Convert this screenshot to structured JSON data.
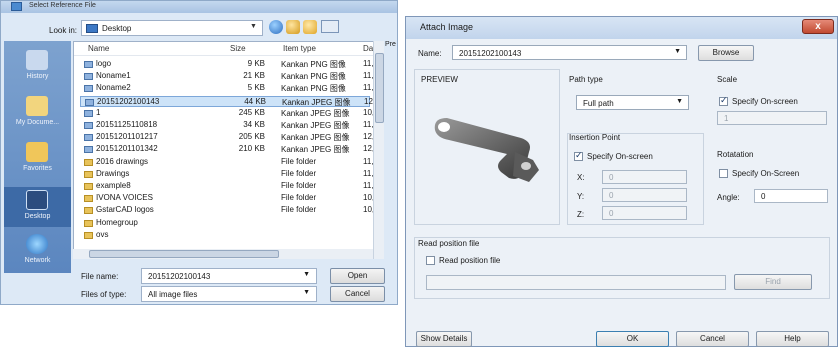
{
  "file_dialog": {
    "title": "Select Reference File",
    "look_in_label": "Look in:",
    "look_in_value": "Desktop",
    "places": [
      "History",
      "My Docume...",
      "Desktop",
      "Favorites",
      "Network"
    ],
    "columns": {
      "name": "Name",
      "size": "Size",
      "type": "Item type",
      "date": "Da"
    },
    "rows": [
      {
        "name": "logo",
        "size": "9 KB",
        "type": "Kankan PNG 图像",
        "date": "11,"
      },
      {
        "name": "Noname1",
        "size": "21 KB",
        "type": "Kankan PNG 图像",
        "date": "11,"
      },
      {
        "name": "Noname2",
        "size": "5 KB",
        "type": "Kankan PNG 图像",
        "date": "11,"
      },
      {
        "name": "20151202100143",
        "size": "44 KB",
        "type": "Kankan JPEG 图像",
        "date": "12,"
      },
      {
        "name": "1",
        "size": "245 KB",
        "type": "Kankan JPEG 图像",
        "date": "10,"
      },
      {
        "name": "20151125110818",
        "size": "34 KB",
        "type": "Kankan JPEG 图像",
        "date": "11,"
      },
      {
        "name": "20151201101217",
        "size": "205 KB",
        "type": "Kankan JPEG 图像",
        "date": "12,"
      },
      {
        "name": "20151201101342",
        "size": "210 KB",
        "type": "Kankan JPEG 图像",
        "date": "12,"
      },
      {
        "name": "2016 drawings",
        "size": "",
        "type": "File folder",
        "date": "11,"
      },
      {
        "name": "Drawings",
        "size": "",
        "type": "File folder",
        "date": "11,"
      },
      {
        "name": "example8",
        "size": "",
        "type": "File folder",
        "date": "11,"
      },
      {
        "name": "IVONA VOICES",
        "size": "",
        "type": "File folder",
        "date": "10,"
      },
      {
        "name": "GstarCAD logos",
        "size": "",
        "type": "File folder",
        "date": "10,"
      },
      {
        "name": "Homegroup",
        "size": "",
        "type": "",
        "date": ""
      },
      {
        "name": "ovs",
        "size": "",
        "type": "",
        "date": ""
      }
    ],
    "selected_row": 3,
    "file_name_label": "File name:",
    "file_name_value": "20151202100143",
    "files_of_type_label": "Files of type:",
    "files_of_type_value": "All image files",
    "open_label": "Open",
    "cancel_label": "Cancel",
    "pre_label": "Pre"
  },
  "attach_dialog": {
    "title": "Attach Image",
    "close_label": "x",
    "name_label": "Name:",
    "name_value": "20151202100143",
    "browse_label": "Browse",
    "preview_label": "PREVIEW",
    "path_type_label": "Path type",
    "path_type_value": "Full path",
    "scale_label": "Scale",
    "scale_checkbox_label": "Specify On-screen",
    "scale_value": "1",
    "insertion_label": "Insertion Point",
    "insertion_checkbox_label": "Specify On-screen",
    "x_label": "X:",
    "x_value": "0",
    "y_label": "Y:",
    "y_value": "0",
    "z_label": "Z:",
    "z_value": "0",
    "rotation_label": "Rotatation",
    "rotation_checkbox_label": "Specify On-Screen",
    "angle_label": "Angle:",
    "angle_value": "0",
    "read_group_label": "Read position file",
    "read_checkbox_label": "Read position file",
    "find_label": "Find",
    "show_details_label": "Show Details",
    "ok_label": "OK",
    "cancel_label": "Cancel",
    "help_label": "Help"
  }
}
